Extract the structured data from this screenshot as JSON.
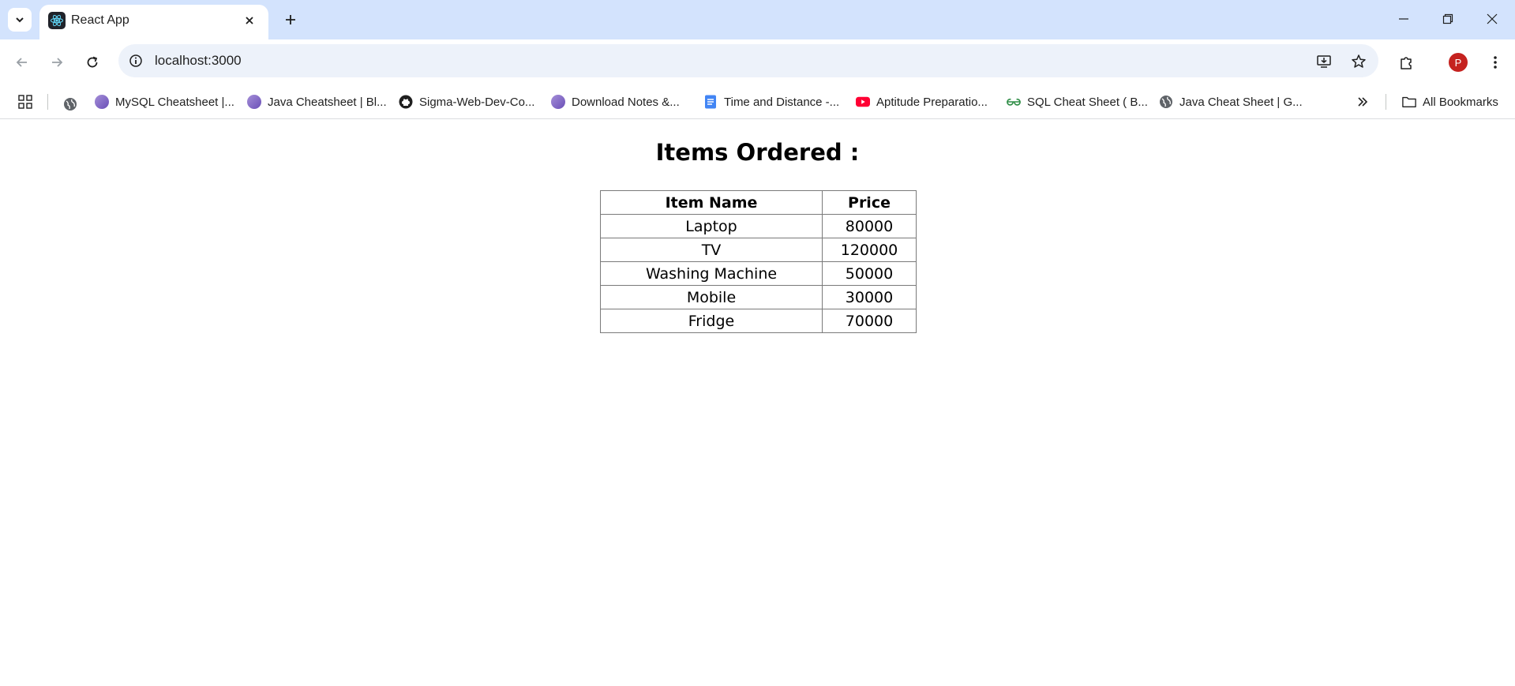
{
  "browser": {
    "tab": {
      "title": "React App",
      "favicon": "react-icon"
    },
    "address_bar": {
      "url": "localhost:3000"
    },
    "profile_initial": "P",
    "colors": {
      "tabstrip": "#d3e3fd",
      "omnibox": "#edf2fa",
      "avatar": "#c5221f"
    }
  },
  "bookmarks": {
    "items": [
      {
        "label": "MySQL Cheatsheet |...",
        "icon": "avatar-icon"
      },
      {
        "label": "Java Cheatsheet | Bl...",
        "icon": "avatar-icon"
      },
      {
        "label": "Sigma-Web-Dev-Co...",
        "icon": "github-icon"
      },
      {
        "label": "Download Notes &...",
        "icon": "avatar-icon"
      },
      {
        "label": "Time and Distance -...",
        "icon": "docs-icon"
      },
      {
        "label": "Aptitude Preparatio...",
        "icon": "youtube-icon"
      },
      {
        "label": "SQL Cheat Sheet ( B...",
        "icon": "gfg-icon"
      },
      {
        "label": "Java Cheat Sheet | G...",
        "icon": "globe-icon"
      }
    ],
    "all_bookmarks_label": "All Bookmarks"
  },
  "page": {
    "heading": "Items Ordered :",
    "table": {
      "headers": [
        "Item Name",
        "Price"
      ],
      "rows": [
        [
          "Laptop",
          "80000"
        ],
        [
          "TV",
          "120000"
        ],
        [
          "Washing Machine",
          "50000"
        ],
        [
          "Mobile",
          "30000"
        ],
        [
          "Fridge",
          "70000"
        ]
      ]
    }
  }
}
